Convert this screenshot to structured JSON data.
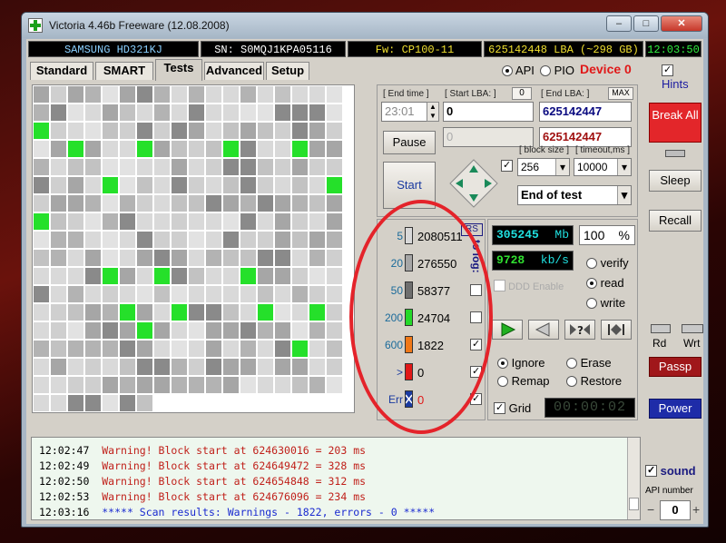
{
  "window": {
    "title": "Victoria 4.46b Freeware (12.08.2008)",
    "buttons": {
      "minimize": "–",
      "maximize": "□",
      "close": "✕"
    }
  },
  "infobar": {
    "model": "SAMSUNG HD321KJ",
    "serial": "SN: S0MQJ1KPA05116",
    "firmware": "Fw: CP100-11",
    "lba": "625142448 LBA (~298 GB)",
    "time": "12:03:50"
  },
  "tabs": [
    "Standard",
    "SMART",
    "Tests",
    "Advanced",
    "Setup"
  ],
  "header": {
    "api": "API",
    "pio": "PIO",
    "device": "Device 0",
    "hints": "Hints"
  },
  "controls": {
    "end_time_label": "[ End time ]",
    "end_time_value": "23:01",
    "start_lba_label": "[ Start LBA: ]",
    "start_lba_zero": "0",
    "end_lba_label": "[ End LBA: ]",
    "end_lba_max": "MAX",
    "start_lba_value": "0",
    "end_lba_value": "625142447",
    "start_lba_value2": "0",
    "end_lba_value2": "625142447",
    "pause": "Pause",
    "start": "Start",
    "block_size_label": "[ block size ]",
    "block_size_value": "256",
    "timeout_label": "[ timeout,ms ]",
    "timeout_value": "10000",
    "end_action": "End of test"
  },
  "legend": {
    "rs": "RS",
    "to_log": "to log:",
    "rows": [
      {
        "threshold": "5",
        "count": "2080511",
        "color": "#d9d9d9",
        "checked": false,
        "show_check": false
      },
      {
        "threshold": "20",
        "count": "276550",
        "color": "#a6a6a6",
        "checked": false,
        "show_check": false
      },
      {
        "threshold": "50",
        "count": "58377",
        "color": "#6e6e6e",
        "checked": false,
        "show_check": true
      },
      {
        "threshold": "200",
        "count": "24704",
        "color": "#25d92a",
        "checked": false,
        "show_check": true
      },
      {
        "threshold": "600",
        "count": "1822",
        "color": "#f07818",
        "checked": true,
        "show_check": true
      },
      {
        "threshold": ">",
        "count": "0",
        "color": "#e01818",
        "checked": true,
        "show_check": true
      },
      {
        "threshold": "Err",
        "count": "0",
        "color": "#1a3aa0",
        "checked": true,
        "show_check": true
      }
    ]
  },
  "stats": {
    "mb_value": "305245",
    "mb_unit": "Mb",
    "percent_value": "100",
    "percent_unit": "%",
    "speed_value": "9728",
    "speed_unit": "kb/s",
    "ddd": "DDD Enable",
    "verify": "verify",
    "read": "read",
    "write": "write",
    "ignore": "Ignore",
    "erase": "Erase",
    "remap": "Remap",
    "restore": "Restore",
    "grid": "Grid",
    "timer": "00:00:02"
  },
  "side": {
    "break_all": "Break All",
    "sleep": "Sleep",
    "recall": "Recall",
    "rd": "Rd",
    "wrt": "Wrt",
    "passp": "Passp",
    "power": "Power",
    "sound": "sound",
    "api_number_label": "API number",
    "api_number_value": "0",
    "minus": "−",
    "plus": "+"
  },
  "log": [
    {
      "time": "12:02:47",
      "text": "Warning! Block start at 624630016 = 203 ms",
      "color": "#c0201a"
    },
    {
      "time": "12:02:49",
      "text": "Warning! Block start at 624649472 = 328 ms",
      "color": "#c0201a"
    },
    {
      "time": "12:02:50",
      "text": "Warning! Block start at 624654848 = 312 ms",
      "color": "#c0201a"
    },
    {
      "time": "12:02:53",
      "text": "Warning! Block start at 624676096 = 234 ms",
      "color": "#c0201a"
    },
    {
      "time": "12:03:16",
      "text": "***** Scan results: Warnings - 1822, errors - 0 *****",
      "color": "#1a2ad0"
    }
  ]
}
